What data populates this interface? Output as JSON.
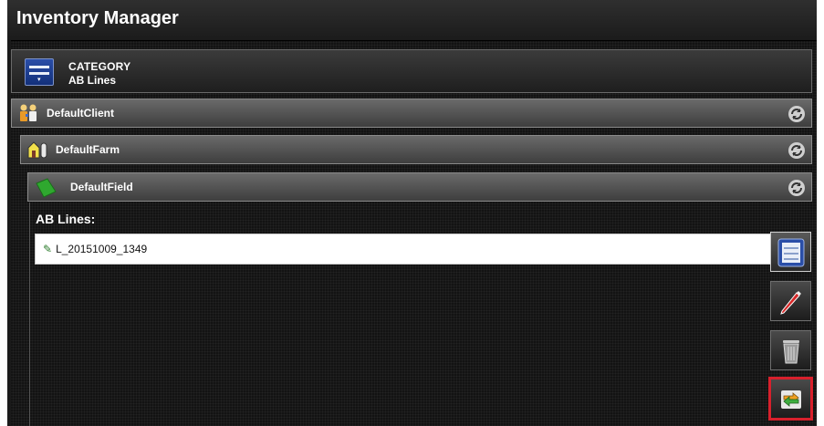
{
  "app": {
    "title": "Inventory Manager"
  },
  "category": {
    "label": "CATEGORY",
    "value": "AB Lines",
    "icon": "category-list-icon"
  },
  "hierarchy": {
    "client": {
      "label": "DefaultClient",
      "icon": "client-people-icon"
    },
    "farm": {
      "label": "DefaultFarm",
      "icon": "farm-barn-icon"
    },
    "field": {
      "label": "DefaultField",
      "icon": "field-green-icon"
    }
  },
  "section": {
    "heading": "AB Lines:"
  },
  "list": {
    "items": [
      {
        "label": "L_20151009_1349",
        "icon": "pen-icon"
      }
    ]
  },
  "side_buttons": [
    {
      "icon": "details-list-icon",
      "state": "active"
    },
    {
      "icon": "edit-pencil-icon"
    },
    {
      "icon": "delete-trash-icon"
    },
    {
      "icon": "transfer-arrows-icon",
      "state": "highlighted"
    }
  ],
  "colors": {
    "highlight": "#d8202c",
    "category_blue": "#2a4ea8",
    "field_green": "#2fa82f"
  }
}
